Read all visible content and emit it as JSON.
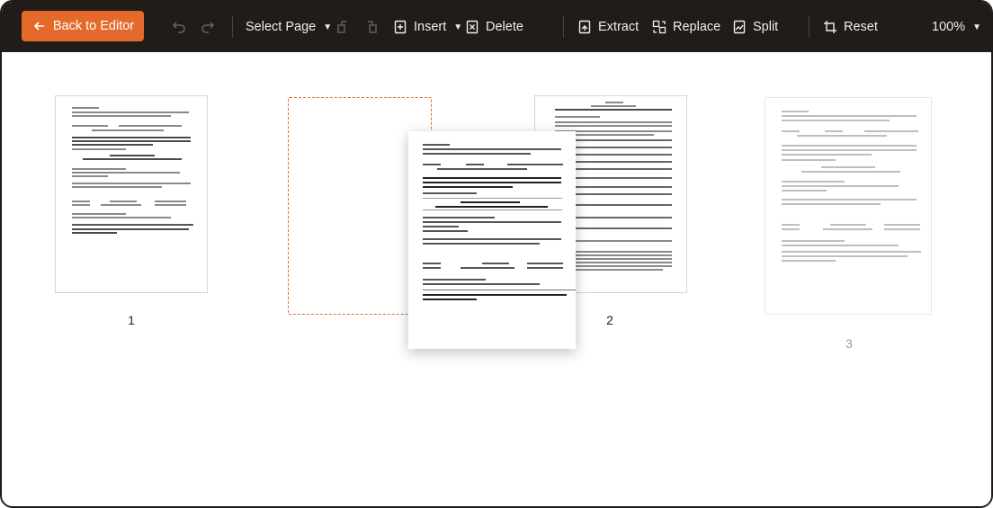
{
  "toolbar": {
    "back_label": "Back to Editor",
    "select_page_label": "Select Page",
    "insert_label": "Insert",
    "delete_label": "Delete",
    "extract_label": "Extract",
    "replace_label": "Replace",
    "split_label": "Split",
    "reset_label": "Reset",
    "zoom_label": "100%"
  },
  "pages": [
    {
      "number": "1"
    },
    {
      "number": "2"
    },
    {
      "number": "3"
    }
  ],
  "colors": {
    "accent": "#e46a2c",
    "toolbar_bg": "#211c18"
  }
}
